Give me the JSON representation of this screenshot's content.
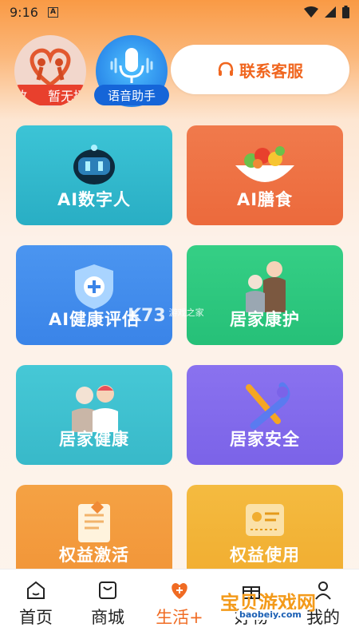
{
  "status_bar": {
    "time": "9:16",
    "sim_badge": "A"
  },
  "header": {
    "broadcast_label_left": "放",
    "broadcast_label_right": "暂无播",
    "voice_label": "语音助手",
    "service_button": "联系客服"
  },
  "tiles": [
    {
      "label": "AI数字人"
    },
    {
      "label": "AI膳食"
    },
    {
      "label": "AI健康评估"
    },
    {
      "label": "居家康护"
    },
    {
      "label": "居家健康"
    },
    {
      "label": "居家安全"
    },
    {
      "label": "权益激活"
    },
    {
      "label": "权益使用"
    }
  ],
  "tab_bar": [
    {
      "label": "首页",
      "icon": "home-icon"
    },
    {
      "label": "商城",
      "icon": "shopping-bag-icon"
    },
    {
      "label": "生活+",
      "icon": "heart-plus-icon"
    },
    {
      "label": "好物",
      "icon": "gift-icon"
    },
    {
      "label": "我的",
      "icon": "user-icon"
    }
  ],
  "watermark": {
    "mid": "K73",
    "mid_small": "游戏之家",
    "bottom": "宝贝游戏网",
    "bottom_url": "baobeiy.com"
  },
  "colors": {
    "accent": "#f06b23",
    "red_badge": "#e8402d",
    "blue_badge": "#1565d8"
  }
}
